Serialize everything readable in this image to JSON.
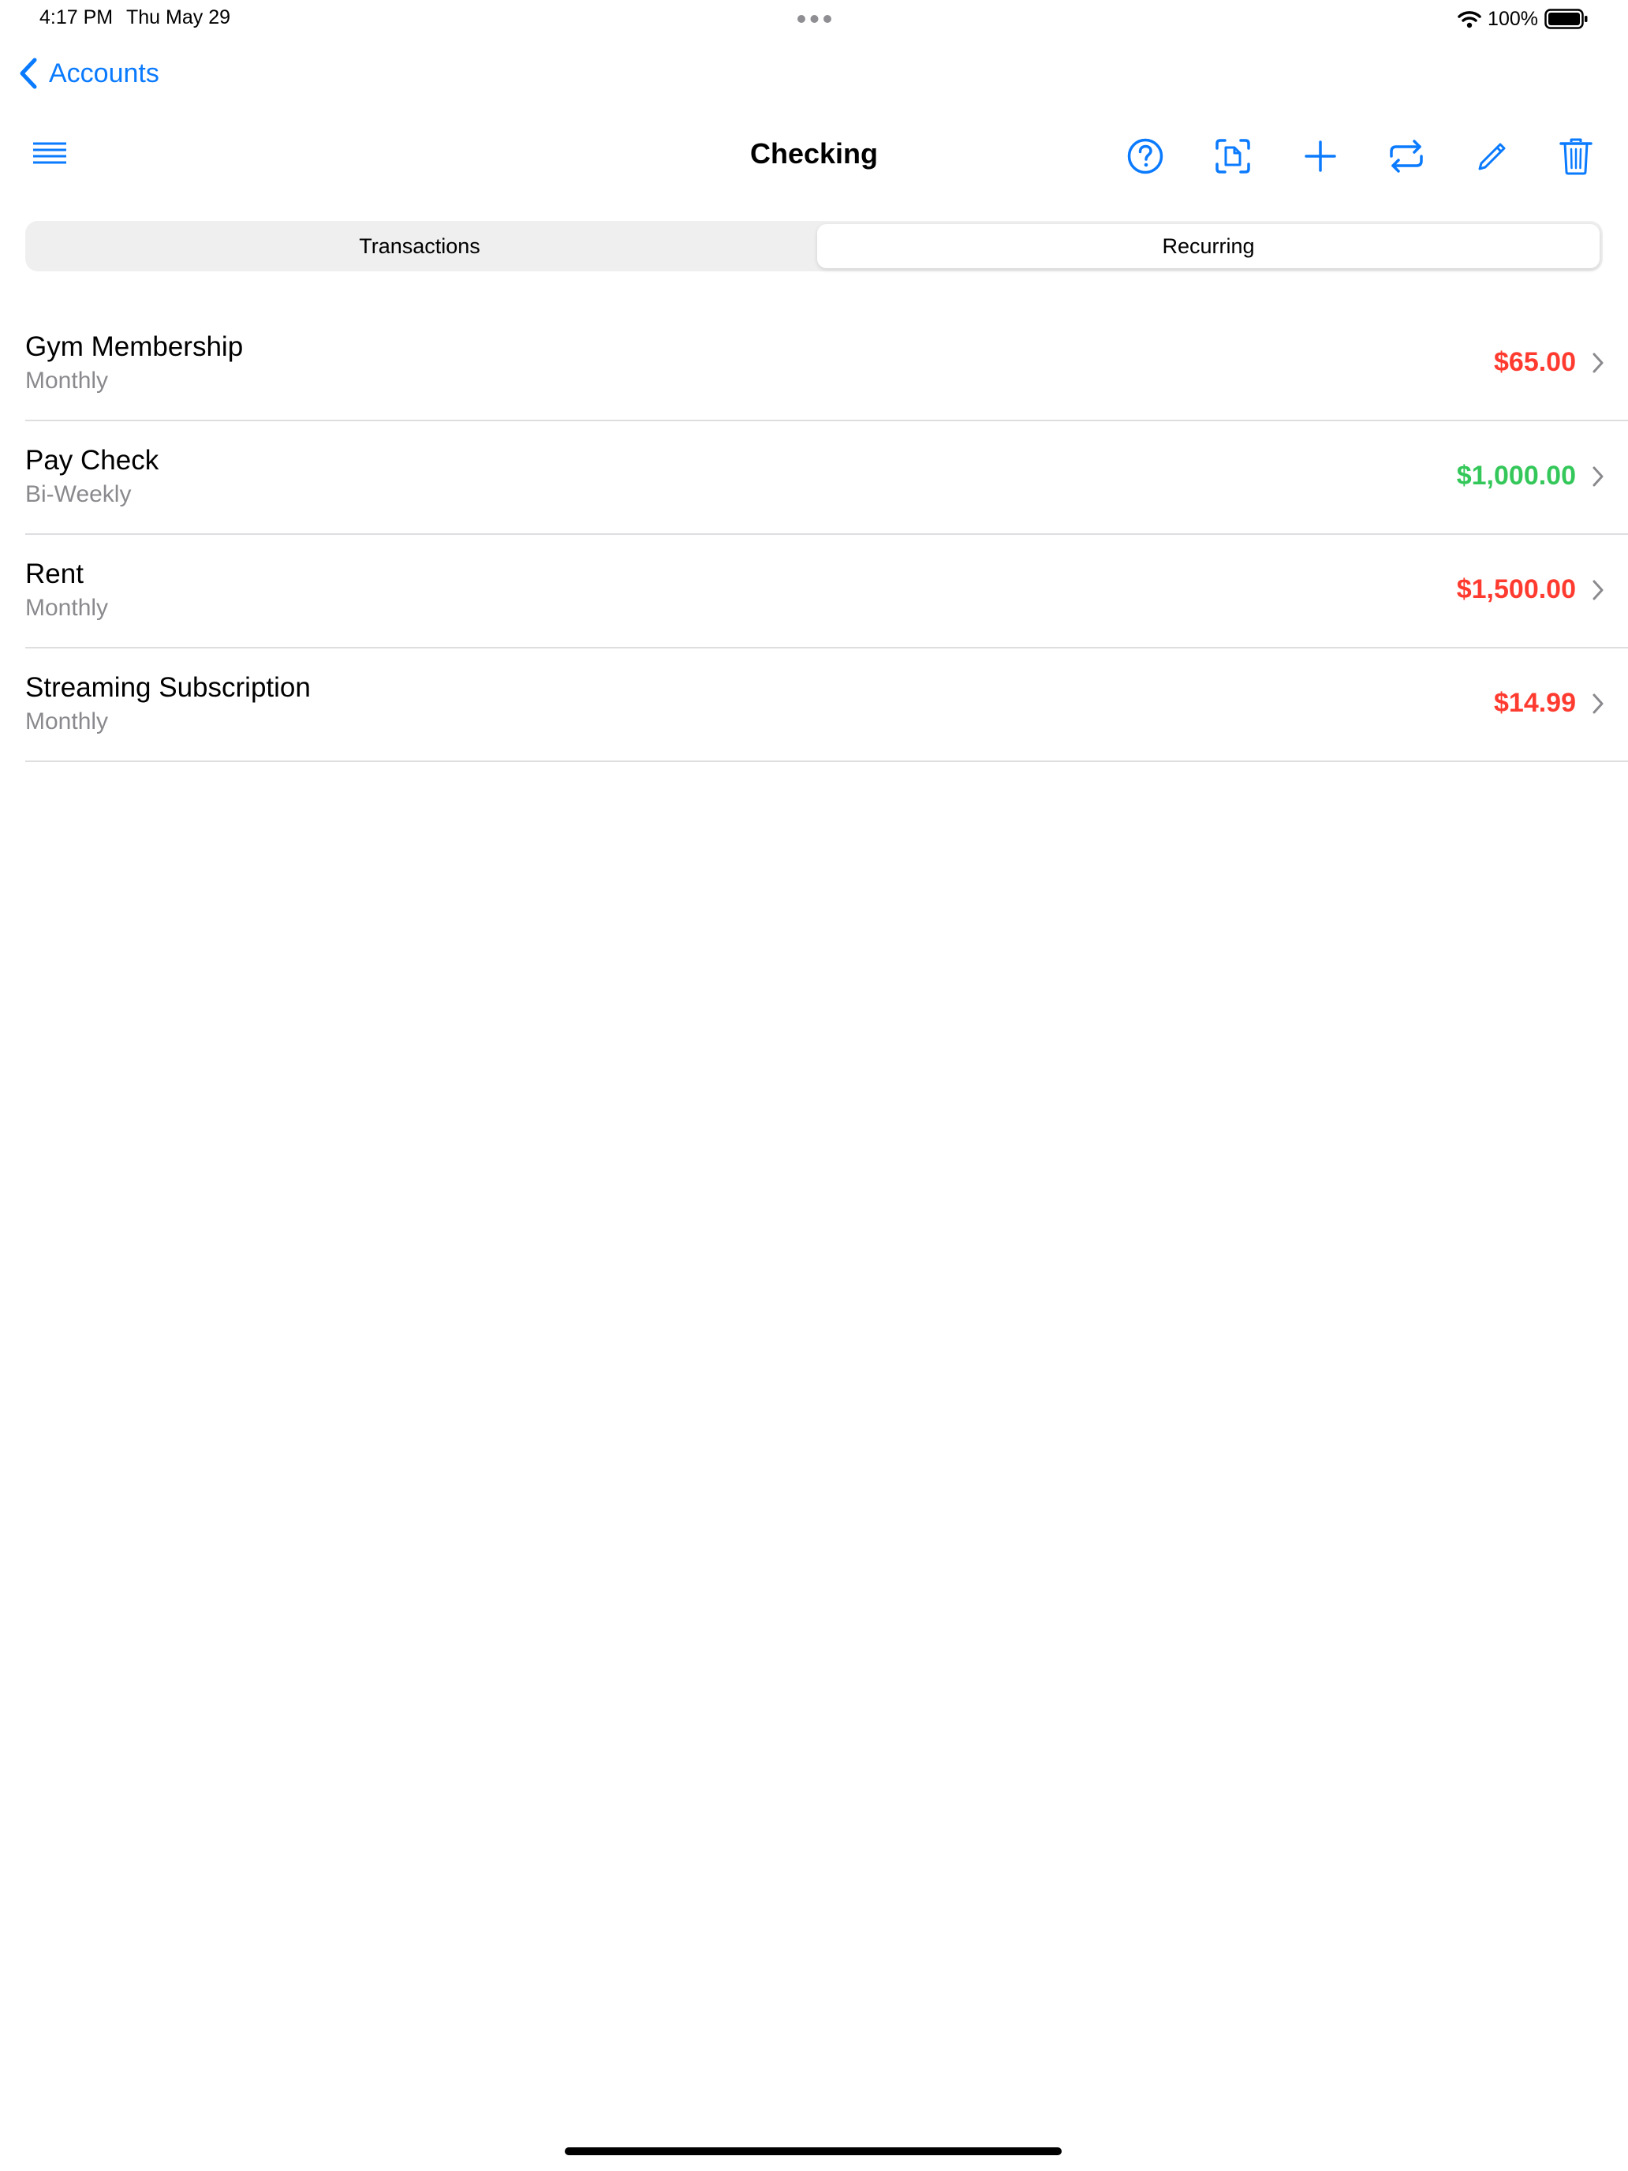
{
  "status_bar": {
    "time": "4:17 PM",
    "date": "Thu May 29",
    "battery_percent": "100%",
    "icons": [
      "wifi-icon",
      "battery-icon",
      "multitask-dots-icon"
    ]
  },
  "nav": {
    "back_label": "Accounts",
    "title": "Checking"
  },
  "toolbar": {
    "buttons": [
      "help-icon",
      "scan-document-icon",
      "add-icon",
      "transfer-icon",
      "edit-icon",
      "trash-icon"
    ]
  },
  "segments": {
    "items": [
      "Transactions",
      "Recurring"
    ],
    "selected": "Recurring"
  },
  "recurring": [
    {
      "title": "Gym Membership",
      "frequency": "Monthly",
      "amount": "$65.00",
      "type": "expense"
    },
    {
      "title": "Pay Check",
      "frequency": "Bi-Weekly",
      "amount": "$1,000.00",
      "type": "income"
    },
    {
      "title": "Rent",
      "frequency": "Monthly",
      "amount": "$1,500.00",
      "type": "expense"
    },
    {
      "title": "Streaming Subscription",
      "frequency": "Monthly",
      "amount": "$14.99",
      "type": "expense"
    }
  ],
  "colors": {
    "accent": "#0a7aff",
    "expense": "#ff3b30",
    "income": "#34c759",
    "secondary_text": "#8a8a8e",
    "separator": "#dedee0"
  }
}
